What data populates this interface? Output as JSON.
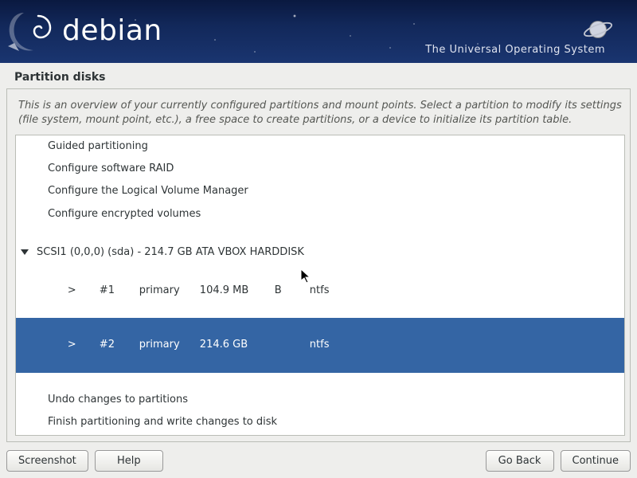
{
  "banner": {
    "brand": "debian",
    "tagline": "The Universal Operating System"
  },
  "page_title": "Partition disks",
  "instructions": "This is an overview of your currently configured partitions and mount points. Select a partition to modify its settings (file system, mount point, etc.), a free space to create partitions, or a device to initialize its partition table.",
  "menu": {
    "guided": "Guided partitioning",
    "raid": "Configure software RAID",
    "lvm": "Configure the Logical Volume Manager",
    "encrypted": "Configure encrypted volumes"
  },
  "disk": {
    "label": "SCSI1 (0,0,0) (sda) - 214.7 GB ATA VBOX HARDDISK",
    "partitions": [
      {
        "arrow": ">",
        "num": "#1",
        "type": "primary",
        "size": "104.9 MB",
        "flag": "B",
        "fs": "ntfs",
        "selected": false
      },
      {
        "arrow": ">",
        "num": "#2",
        "type": "primary",
        "size": "214.6 GB",
        "flag": "",
        "fs": "ntfs",
        "selected": true
      }
    ]
  },
  "actions": {
    "undo": "Undo changes to partitions",
    "finish": "Finish partitioning and write changes to disk"
  },
  "buttons": {
    "screenshot": "Screenshot",
    "help": "Help",
    "go_back": "Go Back",
    "continue": "Continue"
  }
}
